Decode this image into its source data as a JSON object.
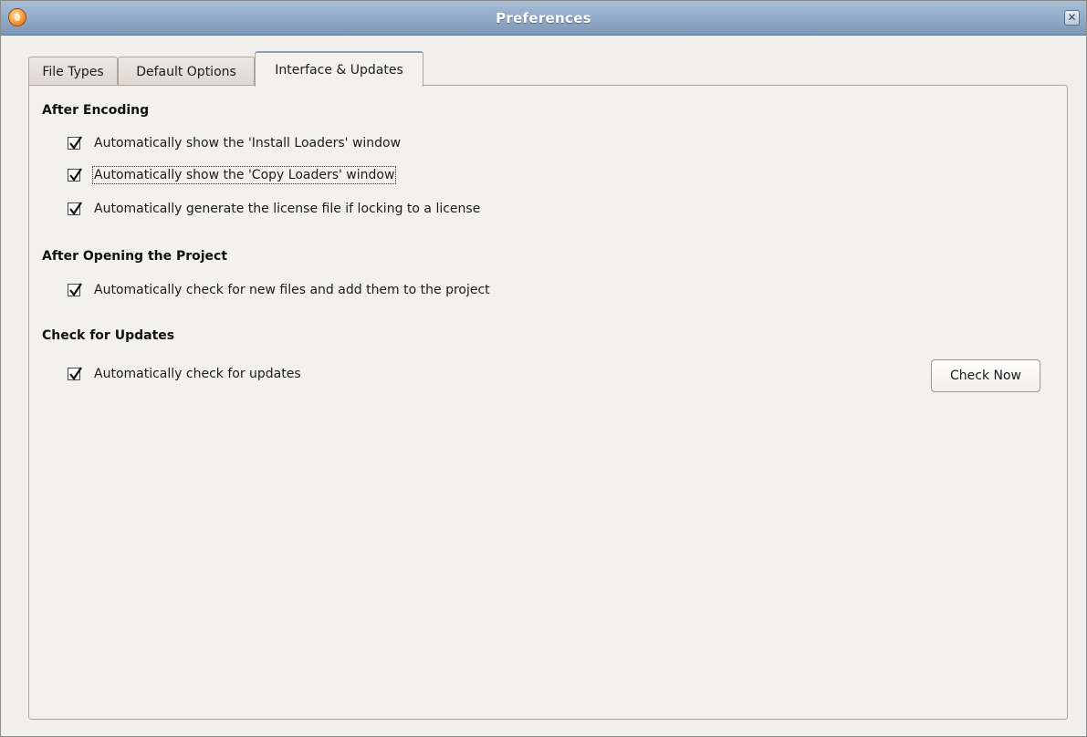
{
  "window": {
    "title": "Preferences",
    "icons": {
      "app": "app-flame-icon",
      "close": "close-icon"
    }
  },
  "tabs": [
    {
      "label": "File Types",
      "active": false
    },
    {
      "label": "Default Options",
      "active": false
    },
    {
      "label": "Interface & Updates",
      "active": true
    }
  ],
  "sections": {
    "after_encoding": {
      "heading": "After Encoding",
      "options": [
        {
          "label": "Automatically show the 'Install Loaders' window",
          "checked": true
        },
        {
          "label": "Automatically show the 'Copy Loaders' window",
          "checked": true,
          "focused": true
        },
        {
          "label": "Automatically generate the license file if locking to a license",
          "checked": true
        }
      ]
    },
    "after_opening": {
      "heading": "After Opening the Project",
      "options": [
        {
          "label": "Automatically check for new files and add them to the project",
          "checked": true
        }
      ]
    },
    "check_updates": {
      "heading": "Check for Updates",
      "options": [
        {
          "label": "Automatically check for updates",
          "checked": true
        }
      ],
      "button_label": "Check Now"
    }
  }
}
